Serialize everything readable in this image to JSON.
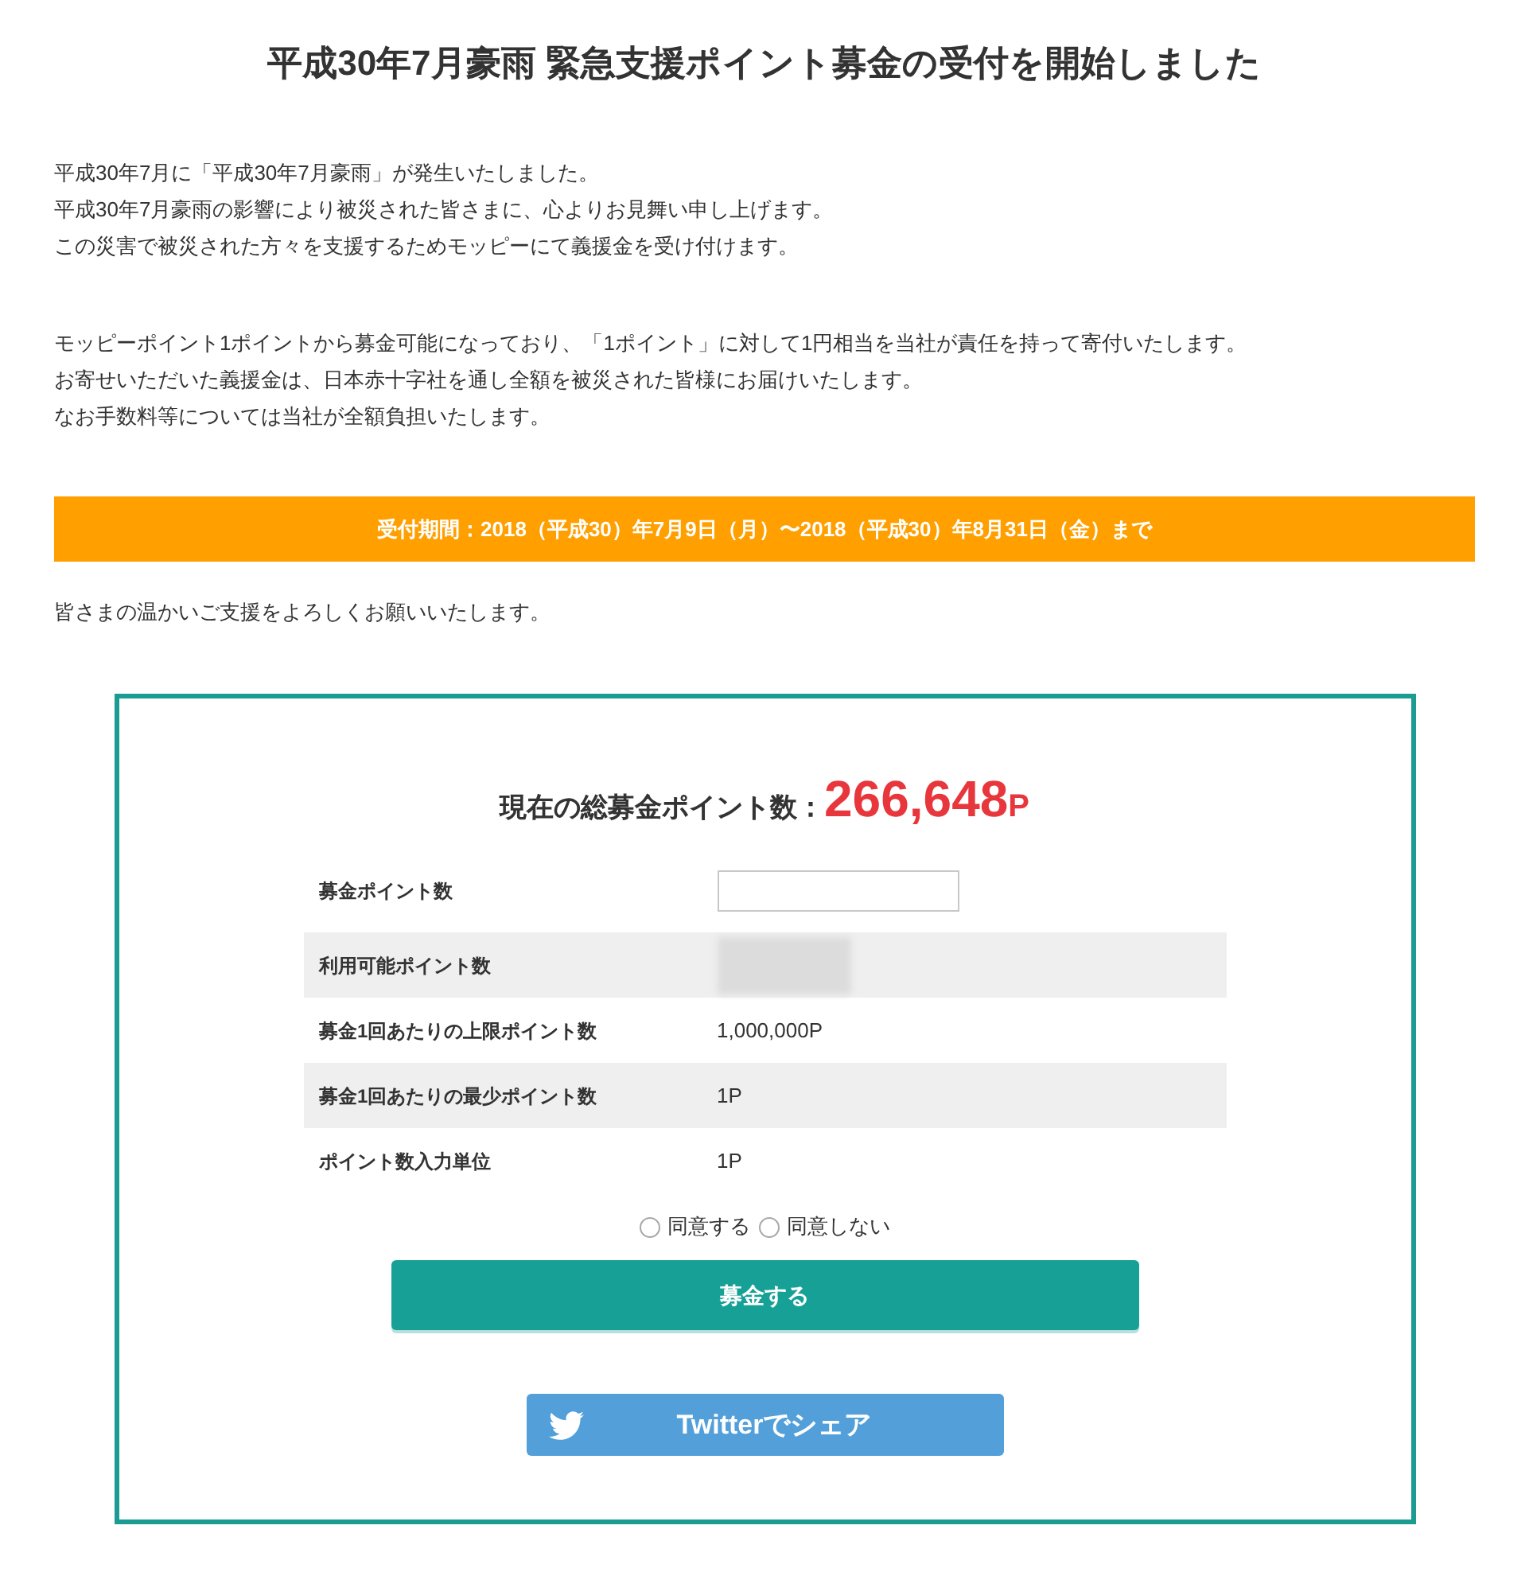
{
  "title": "平成30年7月豪雨 緊急支援ポイント募金の受付を開始しました",
  "paragraphs": [
    {
      "lines": [
        "平成30年7月に「平成30年7月豪雨」が発生いたしました。",
        "平成30年7月豪雨の影響により被災された皆さまに、心よりお見舞い申し上げます。",
        "この災害で被災された方々を支援するためモッピーにて義援金を受け付けます。"
      ]
    },
    {
      "lines": [
        "モッピーポイント1ポイントから募金可能になっており、「1ポイント」に対して1円相当を当社が責任を持って寄付いたします。",
        "お寄せいただいた義援金は、日本赤十字社を通し全額を被災された皆様にお届けいたします。",
        "なお手数料等については当社が全額負担いたします。"
      ]
    }
  ],
  "period_banner": "受付期間：2018（平成30）年7月9日（月）〜2018（平成30）年8月31日（金）まで",
  "closing_text": "皆さまの温かいご支援をよろしくお願いいたします。",
  "donation_card": {
    "total_label": "現在の総募金ポイント数：",
    "total_value": "266,648",
    "total_unit": "P",
    "rows": [
      {
        "kind": "input",
        "label": "募金ポイント数"
      },
      {
        "kind": "redacted",
        "label": "利用可能ポイント数"
      },
      {
        "kind": "text",
        "label": "募金1回あたりの上限ポイント数",
        "value": "1,000,000P"
      },
      {
        "kind": "text",
        "label": "募金1回あたりの最少ポイント数",
        "value": "1P"
      },
      {
        "kind": "text",
        "label": "ポイント数入力単位",
        "value": "1P"
      }
    ],
    "agreement": [
      {
        "label": "同意する",
        "selected": false
      },
      {
        "label": "同意しない",
        "selected": false
      }
    ],
    "submit_button": "募金する",
    "share_button": "Twitterでシェア"
  }
}
